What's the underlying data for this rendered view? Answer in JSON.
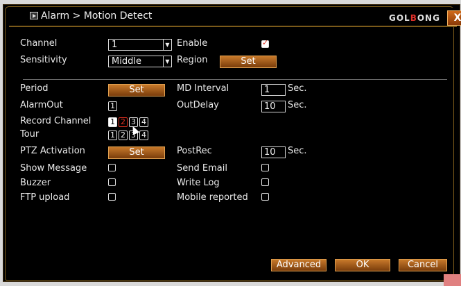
{
  "title": {
    "breadcrumb": "Alarm > Motion Detect",
    "brand_a": "GOL",
    "brand_b": "B",
    "brand_c": "ONG",
    "close": "X"
  },
  "form": {
    "channel": {
      "label": "Channel",
      "value": "1"
    },
    "enable": {
      "label": "Enable",
      "checked": true
    },
    "sensitivity": {
      "label": "Sensitivity",
      "value": "Middle"
    },
    "region": {
      "label": "Region",
      "button": "Set"
    },
    "period": {
      "label": "Period",
      "button": "Set"
    },
    "md_interval": {
      "label": "MD Interval",
      "value": "1",
      "unit": "Sec."
    },
    "alarm_out": {
      "label": "AlarmOut",
      "boxes": [
        "1"
      ]
    },
    "out_delay": {
      "label": "OutDelay",
      "value": "10",
      "unit": "Sec."
    },
    "record_channel": {
      "label": "Record Channel",
      "boxes": [
        "1",
        "2",
        "3",
        "4"
      ]
    },
    "tour": {
      "label": "Tour",
      "boxes": [
        "1",
        "2",
        "3",
        "4"
      ]
    },
    "ptz": {
      "label": "PTZ Activation",
      "button": "Set"
    },
    "post_rec": {
      "label": "PostRec",
      "value": "10",
      "unit": "Sec."
    },
    "show_message": {
      "label": "Show Message"
    },
    "send_email": {
      "label": "Send Email"
    },
    "buzzer": {
      "label": "Buzzer"
    },
    "write_log": {
      "label": "Write Log"
    },
    "ftp_upload": {
      "label": "FTP upload"
    },
    "mobile_reported": {
      "label": "Mobile reported"
    }
  },
  "footer": {
    "advanced": "Advanced",
    "ok": "OK",
    "cancel": "Cancel"
  },
  "colors": {
    "accent": "#c8792a",
    "brand_red": "#e0302a",
    "checkmark": "#e03020"
  }
}
